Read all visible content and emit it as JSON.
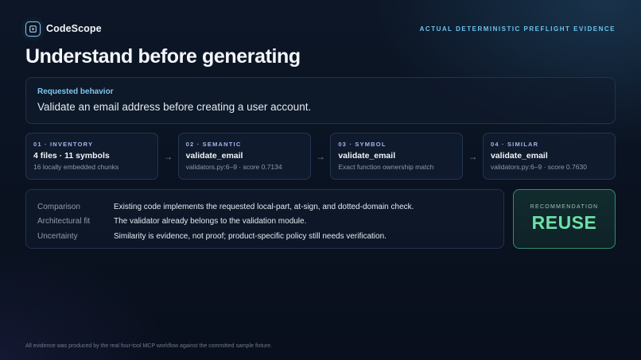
{
  "header": {
    "brand": "CodeScope",
    "tagline": "ACTUAL DETERMINISTIC PREFLIGHT EVIDENCE",
    "logo_icon": "play-square-icon"
  },
  "page_title": "Understand before generating",
  "request": {
    "label": "Requested behavior",
    "text": "Validate an email address before creating a user account."
  },
  "steps": [
    {
      "label": "01 · INVENTORY",
      "title": "4 files · 11 symbols",
      "sub": "16 locally embedded chunks"
    },
    {
      "label": "02 · SEMANTIC",
      "title": "validate_email",
      "sub": "validators.py:6–9 · score 0.7134"
    },
    {
      "label": "03 · SYMBOL",
      "title": "validate_email",
      "sub": "Exact function ownership match"
    },
    {
      "label": "04 · SIMILAR",
      "title": "validate_email",
      "sub": "validators.py:6–9 · score 0.7630"
    }
  ],
  "details": [
    {
      "label": "Comparison",
      "value": "Existing code implements the requested local-part, at-sign, and dotted-domain check."
    },
    {
      "label": "Architectural fit",
      "value": "The validator already belongs to the validation module."
    },
    {
      "label": "Uncertainty",
      "value": "Similarity is evidence, not proof; product-specific policy still needs verification."
    }
  ],
  "recommendation": {
    "label": "RECOMMENDATION",
    "value": "REUSE"
  },
  "footer": "All evidence was produced by the real four-tool MCP workflow against the committed sample fixture.",
  "colors": {
    "accent": "#6cc3ee",
    "step_label": "#a9b4ee",
    "reuse_green": "#6ee0a8",
    "background": "#0a1220"
  }
}
